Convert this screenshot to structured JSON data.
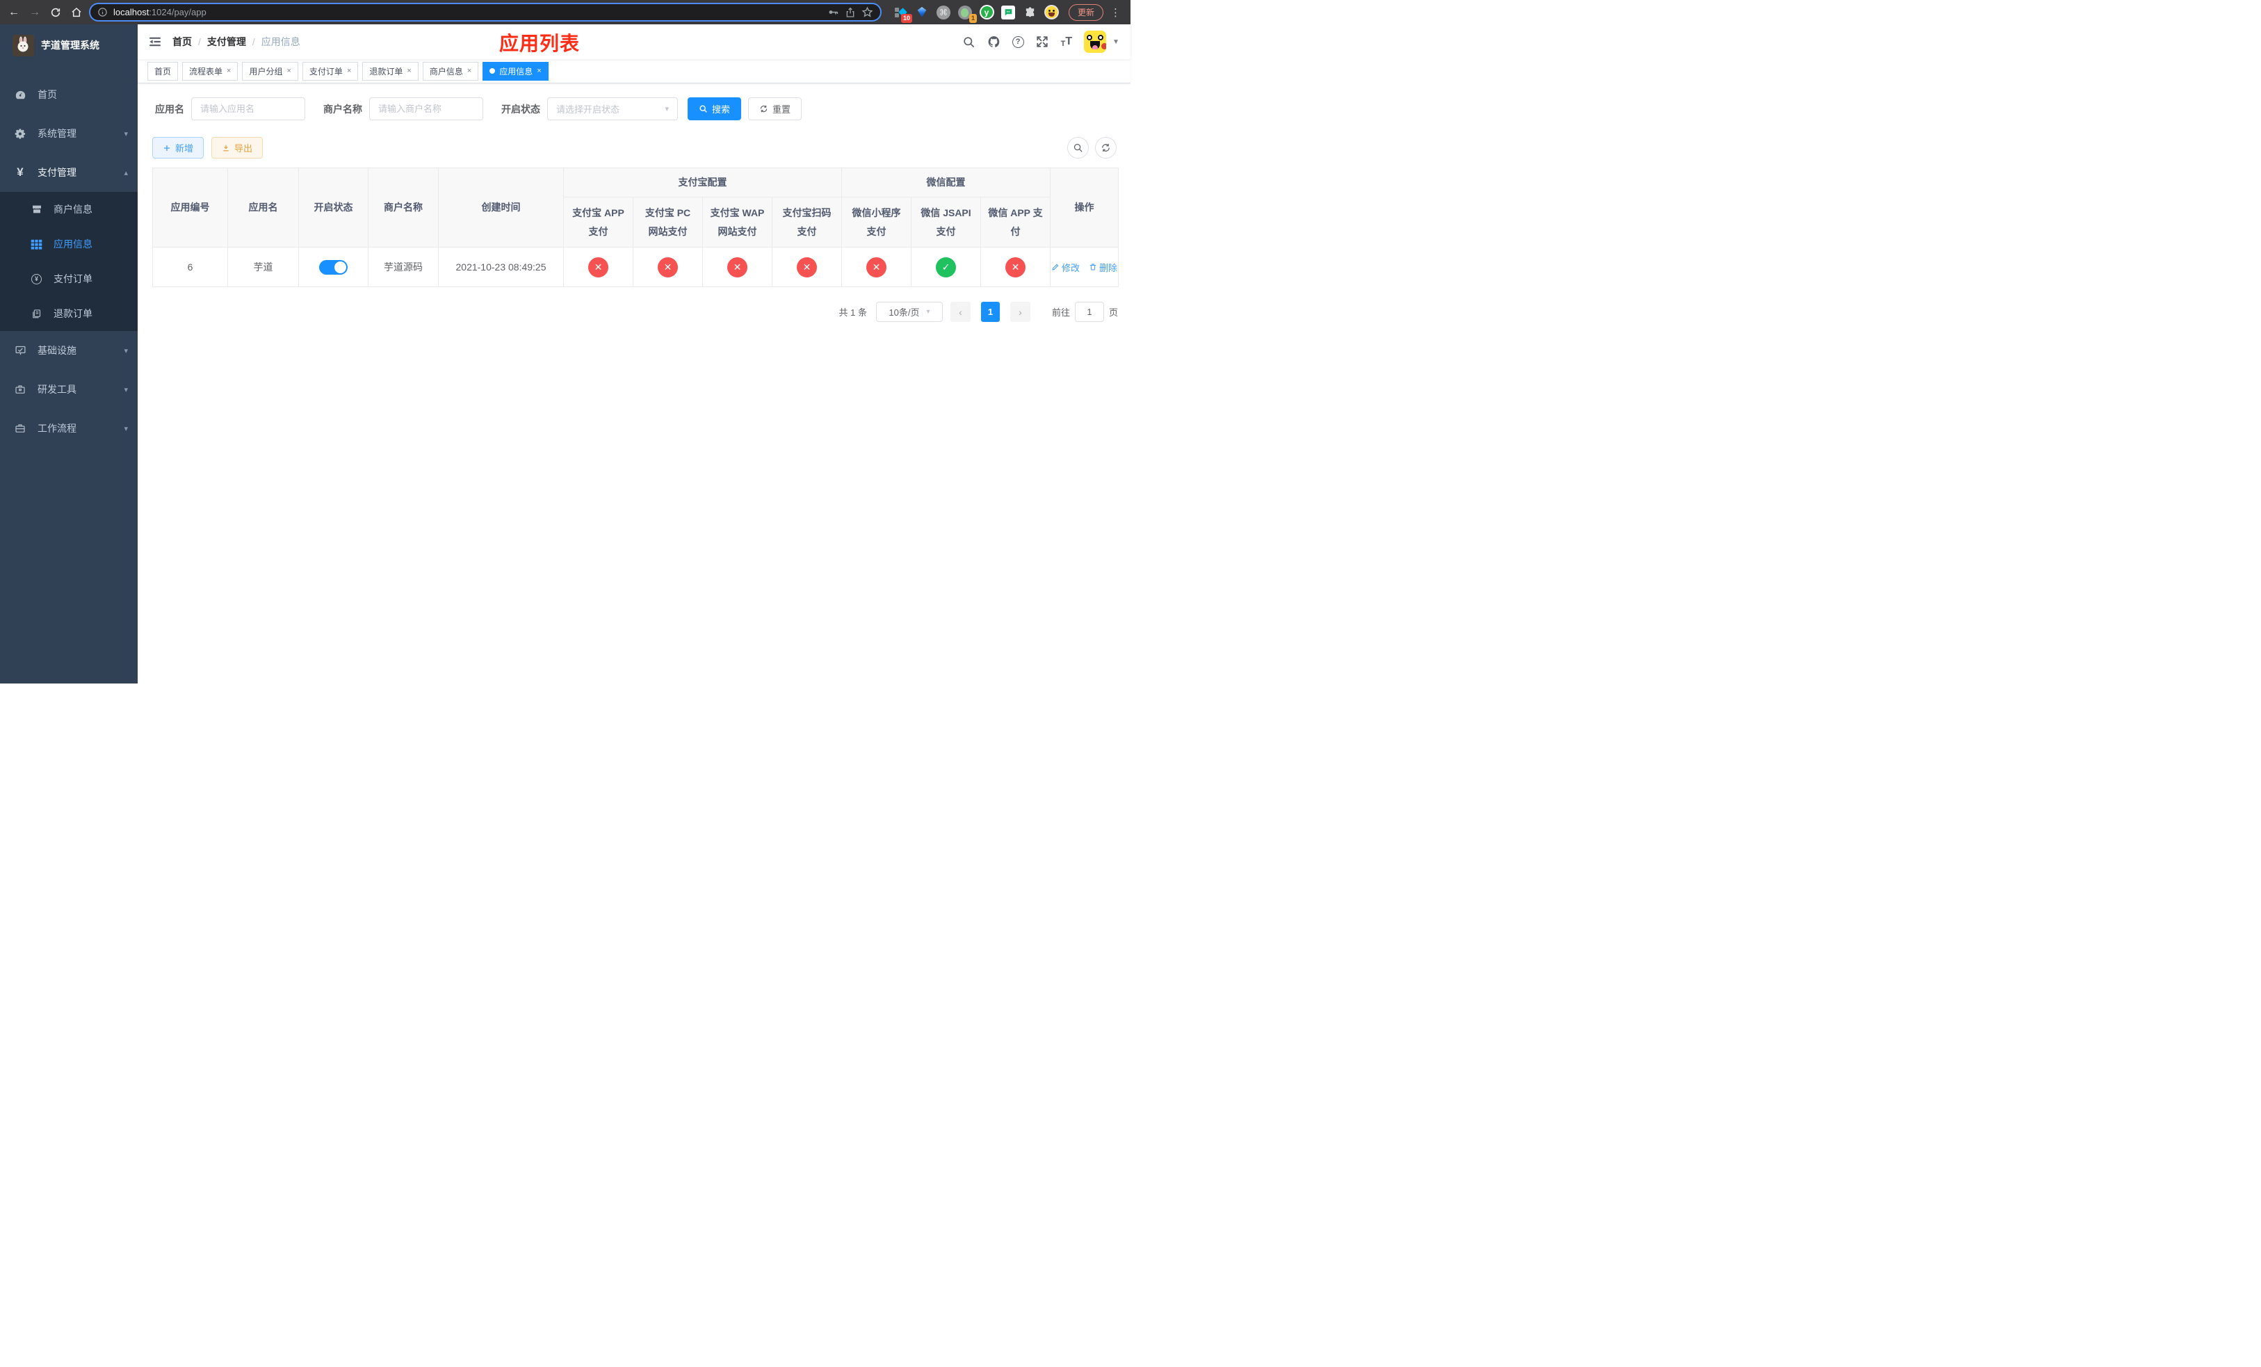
{
  "browser": {
    "url": {
      "host": "localhost",
      "rest": ":1024/pay/app"
    },
    "update_label": "更新",
    "ext_badge_1": "10",
    "ext_badge_2": "1"
  },
  "sidebar": {
    "title": "芋道管理系统",
    "menu": [
      {
        "label": "首页"
      },
      {
        "label": "系统管理"
      },
      {
        "label": "支付管理"
      },
      {
        "label": "基础设施"
      },
      {
        "label": "研发工具"
      },
      {
        "label": "工作流程"
      }
    ],
    "submenu": [
      {
        "label": "商户信息"
      },
      {
        "label": "应用信息"
      },
      {
        "label": "支付订单"
      },
      {
        "label": "退款订单"
      }
    ]
  },
  "header": {
    "breadcrumb": [
      "首页",
      "支付管理",
      "应用信息"
    ],
    "annotation": "应用列表"
  },
  "tabs": [
    "首页",
    "流程表单",
    "用户分组",
    "支付订单",
    "退款订单",
    "商户信息",
    "应用信息"
  ],
  "filter": {
    "app_name_label": "应用名",
    "app_name_placeholder": "请输入应用名",
    "merchant_label": "商户名称",
    "merchant_placeholder": "请输入商户名称",
    "status_label": "开启状态",
    "status_placeholder": "请选择开启状态",
    "search_label": "搜索",
    "reset_label": "重置"
  },
  "toolbar": {
    "add_label": "新增",
    "export_label": "导出"
  },
  "table": {
    "columns": {
      "id": "应用编号",
      "name": "应用名",
      "status": "开启状态",
      "merchant": "商户名称",
      "created": "创建时间",
      "op": "操作"
    },
    "groups": {
      "alipay": "支付宝配置",
      "wechat": "微信配置"
    },
    "subcols": [
      "支付宝 APP 支付",
      "支付宝 PC 网站支付",
      "支付宝 WAP 网站支付",
      "支付宝扫码支付",
      "微信小程序支付",
      "微信 JSAPI 支付",
      "微信 APP 支付"
    ],
    "row": {
      "id": "6",
      "name": "芋道",
      "enabled": true,
      "merchant": "芋道源码",
      "created": "2021-10-23 08:49:25",
      "configs": [
        false,
        false,
        false,
        false,
        false,
        true,
        false
      ],
      "edit_label": "修改",
      "delete_label": "删除"
    }
  },
  "pagination": {
    "total": "共 1 条",
    "page_size": "10条/页",
    "page": "1",
    "goto_prefix": "前往",
    "goto_value": "1",
    "goto_suffix": "页"
  },
  "colors": {
    "accent": "#409eff",
    "primary": "#1890ff",
    "success": "#1fc25f",
    "danger": "#f65252",
    "warning": "#e6a23c",
    "sidebar_bg": "#304156",
    "submenu_bg": "#1f2d3d",
    "annotation_red": "#ff2b14"
  }
}
